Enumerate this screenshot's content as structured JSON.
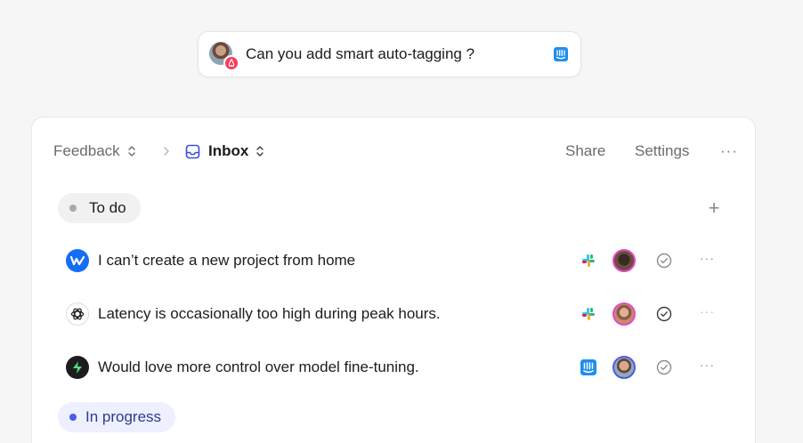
{
  "pill": {
    "text": "Can you add smart auto-tagging ?",
    "avatar": "user-avatar",
    "badge_icon": "airbnb-icon",
    "source_icon": "intercom-icon"
  },
  "breadcrumb": {
    "feedback": "Feedback",
    "inbox": "Inbox"
  },
  "toolbar": {
    "share": "Share",
    "settings": "Settings",
    "more": "···"
  },
  "groups": {
    "todo": "To do",
    "in_progress": "In progress"
  },
  "add_label": "+",
  "rows": [
    {
      "title": "I can’t create a new project from home",
      "logo": "webflow-icon",
      "source": "slack-icon"
    },
    {
      "title": "Latency is occasionally too high during peak hours.",
      "logo": "openai-icon",
      "source": "slack-icon"
    },
    {
      "title": "Would love more control over model fine-tuning.",
      "logo": "bolt-icon",
      "source": "intercom-icon"
    }
  ],
  "row_more": "···",
  "colors": {
    "accent": "#4b5ce8",
    "todo_chip": "#f1f1f1",
    "inprogress_chip": "#eef0ff",
    "airbnb": "#ff385c",
    "intercom": "#1f8ded"
  }
}
